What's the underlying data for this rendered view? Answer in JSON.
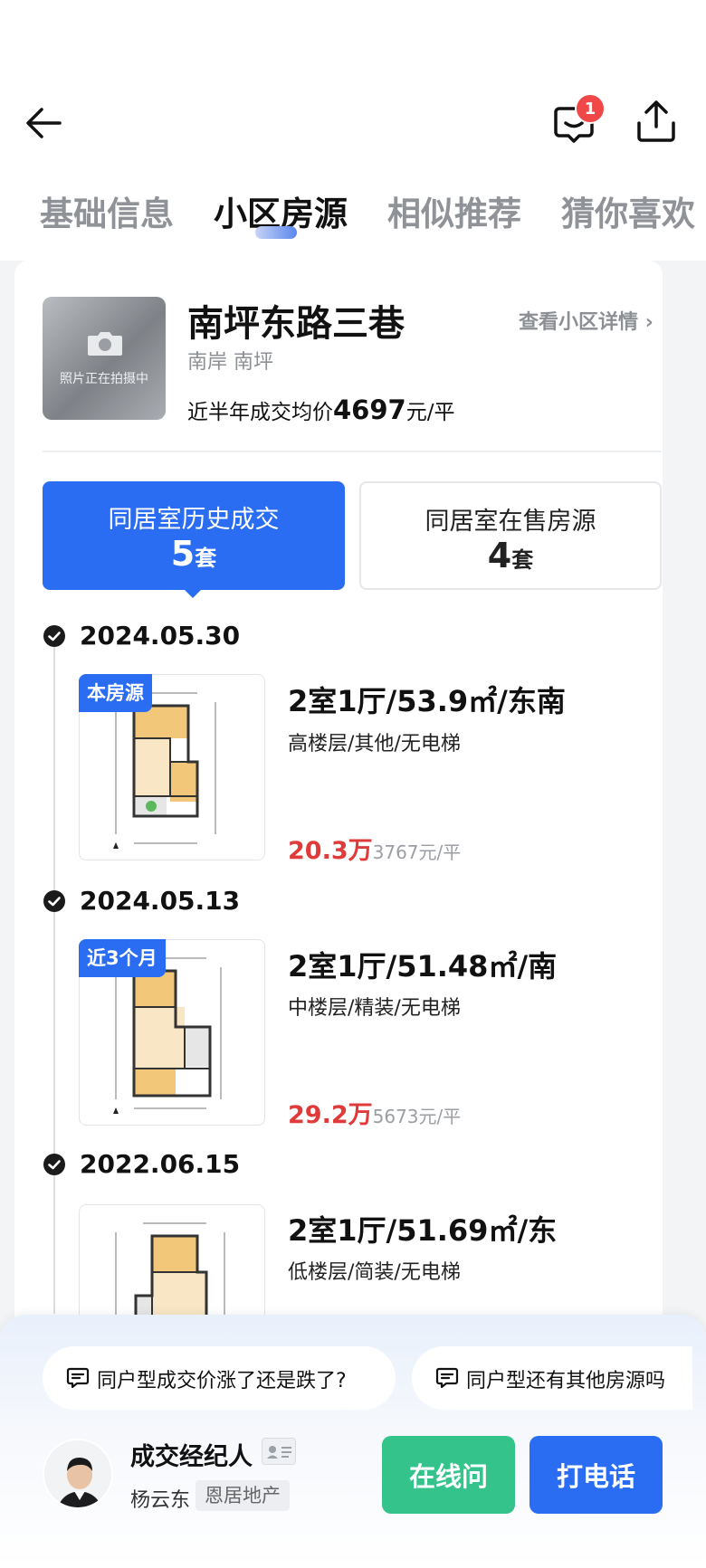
{
  "header": {
    "back_icon": "back-arrow-icon",
    "message_icon": "message-icon",
    "message_badge": "1",
    "share_icon": "share-icon"
  },
  "tabs": [
    {
      "label": "基础信息",
      "active": false
    },
    {
      "label": "小区房源",
      "active": true
    },
    {
      "label": "相似推荐",
      "active": false
    },
    {
      "label": "猜你喜欢",
      "active": false
    }
  ],
  "community": {
    "photo_placeholder": "照片正在拍摄中",
    "name": "南坪东路三巷",
    "area": "南岸 南坪",
    "avg_label": "近半年成交均价",
    "avg_price": "4697",
    "avg_unit": "元/平",
    "detail_link": "查看小区详情"
  },
  "switch": {
    "sold": {
      "label": "同居室历史成交",
      "count": "5",
      "unit": "套"
    },
    "onsale": {
      "label": "同居室在售房源",
      "count": "4",
      "unit": "套"
    }
  },
  "records": [
    {
      "date": "2024.05.30",
      "tag": "本房源",
      "title": "2室1厅/53.9㎡/东南",
      "sub": "高楼层/其他/无电梯",
      "price": "20.3万",
      "unit_price": "3767元/平"
    },
    {
      "date": "2024.05.13",
      "tag": "近3个月",
      "title": "2室1厅/51.48㎡/南",
      "sub": "中楼层/精装/无电梯",
      "price": "29.2万",
      "unit_price": "5673元/平"
    },
    {
      "date": "2022.06.15",
      "tag": "",
      "title": "2室1厅/51.69㎡/东",
      "sub": "低楼层/简装/无电梯",
      "price": "",
      "unit_price": ""
    }
  ],
  "questions": [
    "同户型成交价涨了还是跌了?",
    "同户型还有其他房源吗"
  ],
  "agent": {
    "title": "成交经纪人",
    "name": "杨云东",
    "company": "恩居地产",
    "btn_chat": "在线问",
    "btn_call": "打电话"
  },
  "colors": {
    "accent": "#2a6df2",
    "price": "#e03b3b",
    "chat_button": "#34c48b",
    "badge": "#f04848"
  }
}
